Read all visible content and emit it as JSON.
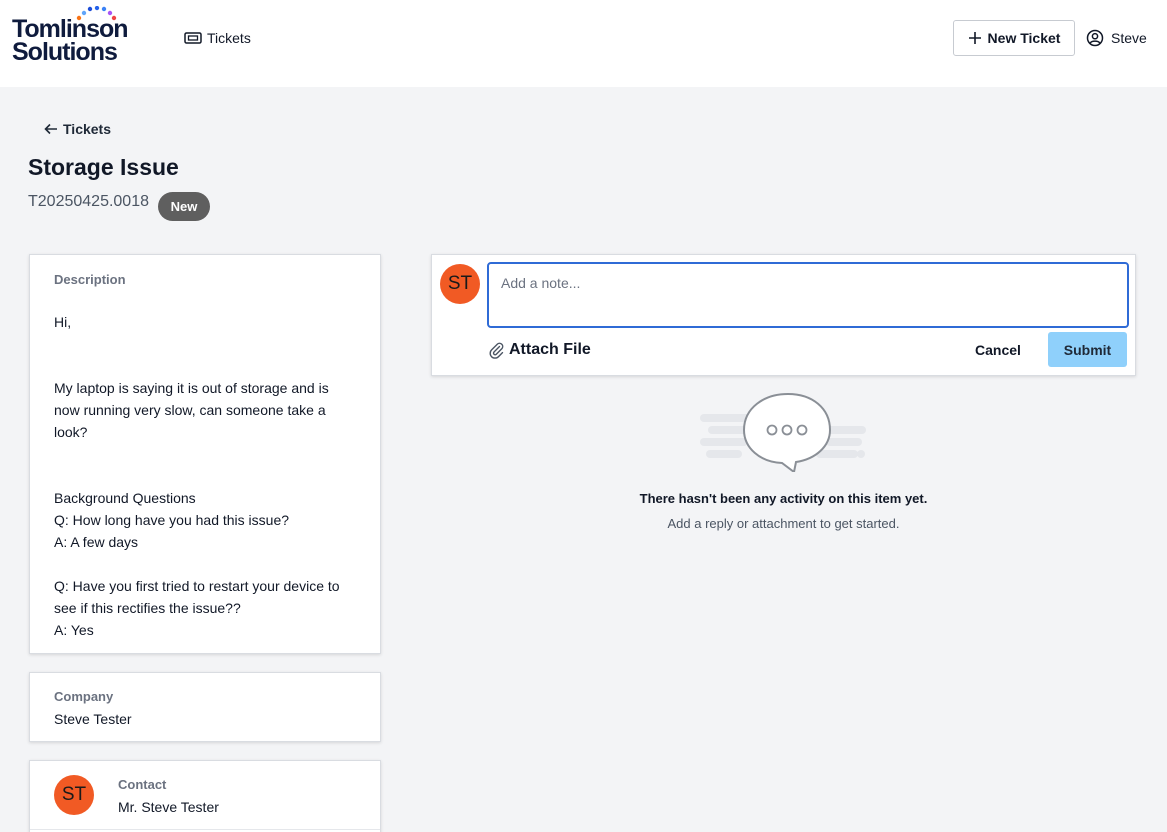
{
  "header": {
    "logo_line1": "Tomlinson",
    "logo_line2": "Solutions",
    "nav_tickets_label": "Tickets",
    "new_ticket_label": "New Ticket",
    "user_name": "Steve",
    "logo_dot_colors": [
      "#1d4ed8",
      "#2563eb",
      "#3b82f6",
      "#60a5fa",
      "#f97316",
      "#ef4444",
      "#a855f7"
    ]
  },
  "ticket": {
    "back_label": "Tickets",
    "title": "Storage Issue",
    "number": "T20250425.0018",
    "status": "New"
  },
  "description": {
    "label": "Description",
    "greeting": "Hi,",
    "message": "My laptop is saying it is out of storage and is now running very slow, can someone take a look?",
    "background_heading": "Background Questions",
    "q1": "Q: How long have you had this issue?",
    "a1": "A: A few days",
    "q2": "Q: Have you first tried to restart your device to see if this rectifies the issue??",
    "a2": "A: Yes"
  },
  "company": {
    "label": "Company",
    "value": "Steve Tester"
  },
  "contact": {
    "label": "Contact",
    "initials": "ST",
    "name": "Mr. Steve Tester"
  },
  "composer": {
    "avatar_initials": "ST",
    "placeholder": "Add a note...",
    "attach_label": "Attach File",
    "cancel_label": "Cancel",
    "submit_label": "Submit"
  },
  "activity": {
    "empty_title": "There hasn't been any activity on this item yet.",
    "empty_subtitle": "Add a reply or attachment to get started."
  },
  "colors": {
    "accent_blue": "#2f6bd6",
    "submit_bg": "#8fd0fb",
    "avatar_bg": "#f15a24",
    "badge_bg": "#5f5f5f"
  },
  "icons": {
    "nav_tickets": "ticket-icon",
    "new_ticket": "plus-icon",
    "user": "user-circle-icon",
    "back": "arrow-left-icon",
    "attach": "paperclip-icon",
    "empty_state": "chat-bubble-icon"
  }
}
